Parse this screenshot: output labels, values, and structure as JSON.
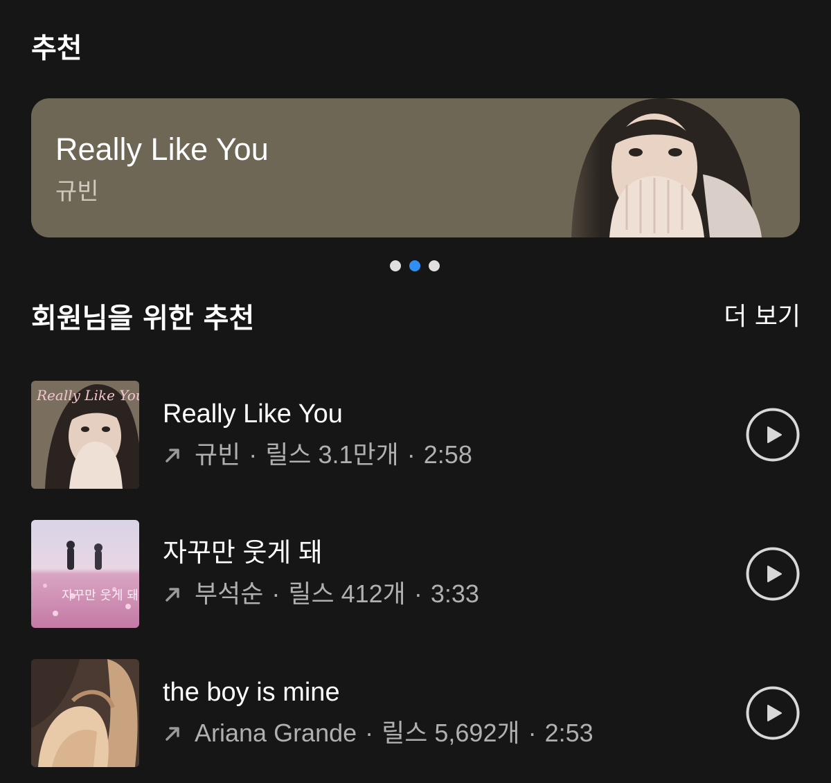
{
  "section": {
    "title": "추천"
  },
  "hero": {
    "title": "Really Like You",
    "artist": "규빈",
    "background": "#6e6756"
  },
  "carousel": {
    "page_count": 3,
    "active_index": 1,
    "active_color": "#2f8ff5"
  },
  "recommendations": {
    "title": "회원님을 위한 추천",
    "see_more": "더 보기",
    "tracks": [
      {
        "title": "Really Like You",
        "artist": "규빈",
        "reels": "릴스 3.1만개",
        "duration": "2:58",
        "cover_text": "Really Like You",
        "cover_icon": "album-cover-portrait"
      },
      {
        "title": "자꾸만 웃게 돼",
        "artist": "부석순",
        "reels": "릴스 412개",
        "duration": "3:33",
        "cover_text": "자꾸만 웃게 돼",
        "cover_icon": "album-cover-flower-field"
      },
      {
        "title": "the boy is mine",
        "artist": "Ariana Grande",
        "reels": "릴스 5,692개",
        "duration": "2:53",
        "cover_icon": "album-cover-hair"
      }
    ]
  },
  "icons": {
    "trend": "trend-arrow-icon",
    "play": "play-circle-icon"
  }
}
